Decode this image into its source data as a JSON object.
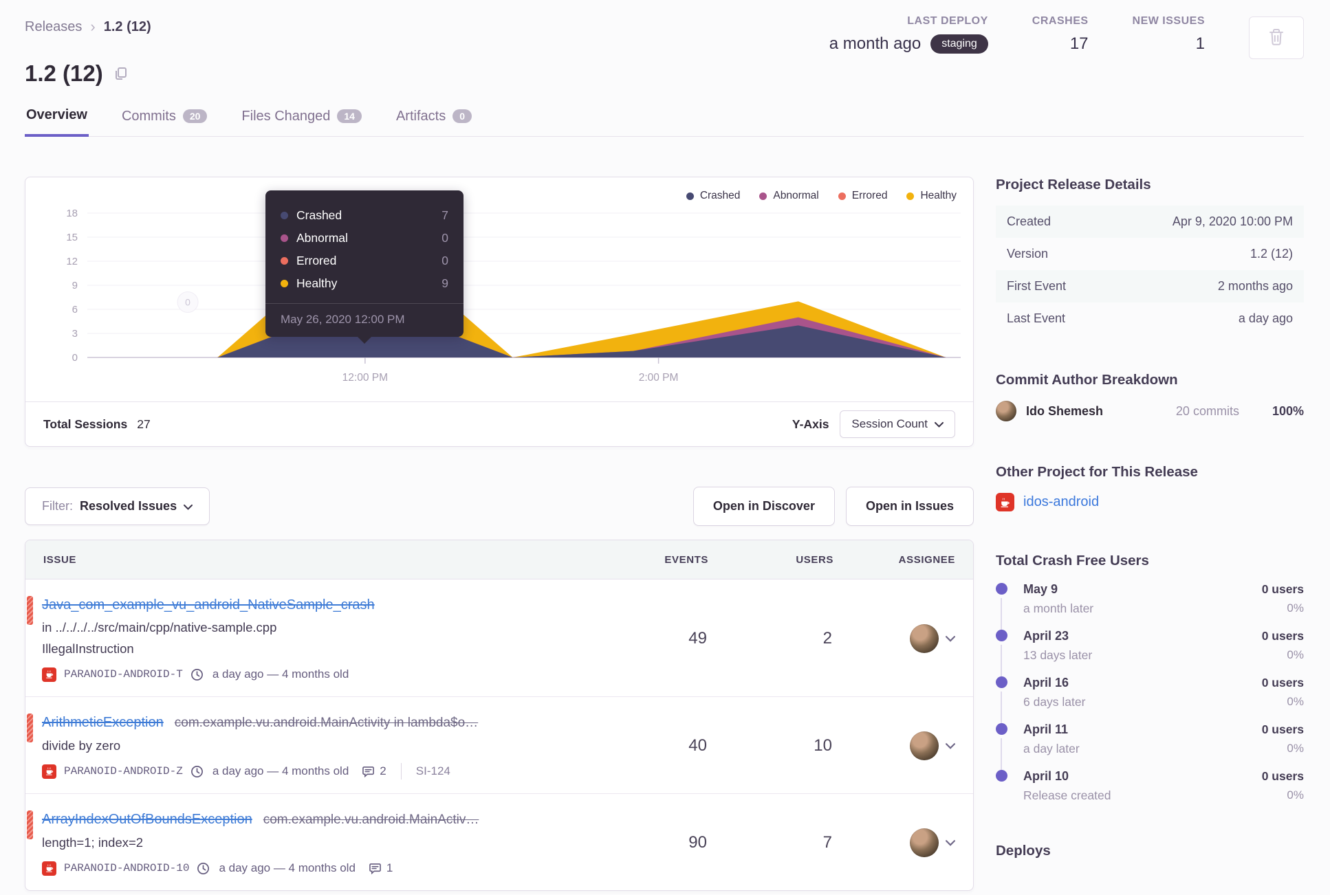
{
  "breadcrumb": {
    "parent": "Releases",
    "current": "1.2 (12)"
  },
  "header_stats": {
    "last_deploy_label": "LAST DEPLOY",
    "last_deploy_value": "a month ago",
    "last_deploy_env": "staging",
    "crashes_label": "CRASHES",
    "crashes_value": "17",
    "new_issues_label": "NEW ISSUES",
    "new_issues_value": "1"
  },
  "page_title": "1.2 (12)",
  "tabs": [
    {
      "label": "Overview",
      "active": true
    },
    {
      "label": "Commits",
      "badge": "20"
    },
    {
      "label": "Files Changed",
      "badge": "14"
    },
    {
      "label": "Artifacts",
      "badge": "0"
    }
  ],
  "chart_data": {
    "type": "area",
    "stacked": true,
    "title": "Release sessions over time",
    "ylabel": "Session Count",
    "ylim": [
      0,
      18
    ],
    "yticks": [
      0,
      3,
      6,
      9,
      12,
      15,
      18
    ],
    "xticks": [
      {
        "label": "12:00 PM",
        "x": 0.318
      },
      {
        "label": "2:00 PM",
        "x": 0.654
      }
    ],
    "legend_position": "top-right",
    "grid": true,
    "series": [
      {
        "key": "crashed",
        "name": "Crashed",
        "color": "#474A72"
      },
      {
        "key": "abnormal",
        "name": "Abnormal",
        "color": "#A9548B"
      },
      {
        "key": "errored",
        "name": "Errored",
        "color": "#EC6E5F"
      },
      {
        "key": "healthy",
        "name": "Healthy",
        "color": "#F2B20E"
      }
    ],
    "points": [
      {
        "x": 0.149,
        "crashed": 0,
        "abnormal": 0,
        "errored": 0,
        "healthy": 0
      },
      {
        "x": 0.318,
        "crashed": 7,
        "abnormal": 0,
        "errored": 0,
        "healthy": 9
      },
      {
        "x": 0.487,
        "crashed": 0,
        "abnormal": 0,
        "errored": 0,
        "healthy": 0
      },
      {
        "x": 0.625,
        "crashed": 0.8,
        "abnormal": 0,
        "errored": 0,
        "healthy": 2.1
      },
      {
        "x": 0.814,
        "crashed": 4,
        "abnormal": 1,
        "errored": 0,
        "healthy": 2
      },
      {
        "x": 0.983,
        "crashed": 0,
        "abnormal": 0,
        "errored": 0,
        "healthy": 0
      }
    ],
    "marker": {
      "label": "0",
      "x": 0.115,
      "y": 6.9
    }
  },
  "tooltip": {
    "rows": [
      {
        "label": "Crashed",
        "value": "7"
      },
      {
        "label": "Abnormal",
        "value": "0"
      },
      {
        "label": "Errored",
        "value": "0"
      },
      {
        "label": "Healthy",
        "value": "9"
      }
    ],
    "footer": "May 26, 2020 12:00 PM"
  },
  "sessions_footer": {
    "total_label": "Total Sessions",
    "total_value": "27",
    "yaxis_label": "Y-Axis",
    "yaxis_value": "Session Count"
  },
  "filter_bar": {
    "filter_label": "Filter:",
    "filter_value": "Resolved Issues",
    "discover_button": "Open in Discover",
    "issues_button": "Open in Issues"
  },
  "issues_table": {
    "columns": [
      "ISSUE",
      "EVENTS",
      "USERS",
      "ASSIGNEE"
    ],
    "rows": [
      {
        "title": "Java_com_example_vu_android_NativeSample_crash",
        "line2": "in ../../../../src/main/cpp/native-sample.cpp",
        "line3": "IllegalInstruction",
        "project": "PARANOID-ANDROID-T",
        "age": "a day ago — 4 months old",
        "events": "49",
        "users": "2"
      },
      {
        "title": "ArithmeticException",
        "title_secondary": "com.example.vu.android.MainActivity in lambda$o…",
        "line2": "divide by zero",
        "project": "PARANOID-ANDROID-Z",
        "age": "a day ago — 4 months old",
        "comments": "2",
        "annotation": "SI-124",
        "events": "40",
        "users": "10"
      },
      {
        "title": "ArrayIndexOutOfBoundsException",
        "title_secondary": "com.example.vu.android.MainActiv…",
        "line2": "length=1; index=2",
        "project": "PARANOID-ANDROID-10",
        "age": "a day ago — 4 months old",
        "comments": "1",
        "events": "90",
        "users": "7"
      }
    ]
  },
  "sidebar": {
    "release_details": {
      "title": "Project Release Details",
      "rows": [
        {
          "label": "Created",
          "value": "Apr 9, 2020 10:00 PM"
        },
        {
          "label": "Version",
          "value": "1.2 (12)"
        },
        {
          "label": "First Event",
          "value": "2 months ago"
        },
        {
          "label": "Last Event",
          "value": "a day ago"
        }
      ]
    },
    "commit_authors": {
      "title": "Commit Author Breakdown",
      "author": "Ido Shemesh",
      "commits": "20 commits",
      "percent": "100%"
    },
    "other_project": {
      "title": "Other Project for This Release",
      "project": "idos-android"
    },
    "crash_free": {
      "title": "Total Crash Free Users",
      "items": [
        {
          "date": "May 9",
          "sub": "a month later",
          "users": "0 users",
          "percent": "0%"
        },
        {
          "date": "April 23",
          "sub": "13 days later",
          "users": "0 users",
          "percent": "0%"
        },
        {
          "date": "April 16",
          "sub": "6 days later",
          "users": "0 users",
          "percent": "0%"
        },
        {
          "date": "April 11",
          "sub": "a day later",
          "users": "0 users",
          "percent": "0%"
        },
        {
          "date": "April 10",
          "sub": "Release created",
          "users": "0 users",
          "percent": "0%"
        }
      ]
    },
    "deploys_title": "Deploys"
  },
  "colors": {
    "accent": "#6C5FC7",
    "link": "#3E7BD6",
    "level_error": "#E8594A",
    "env_pill_bg": "#3E3446"
  }
}
